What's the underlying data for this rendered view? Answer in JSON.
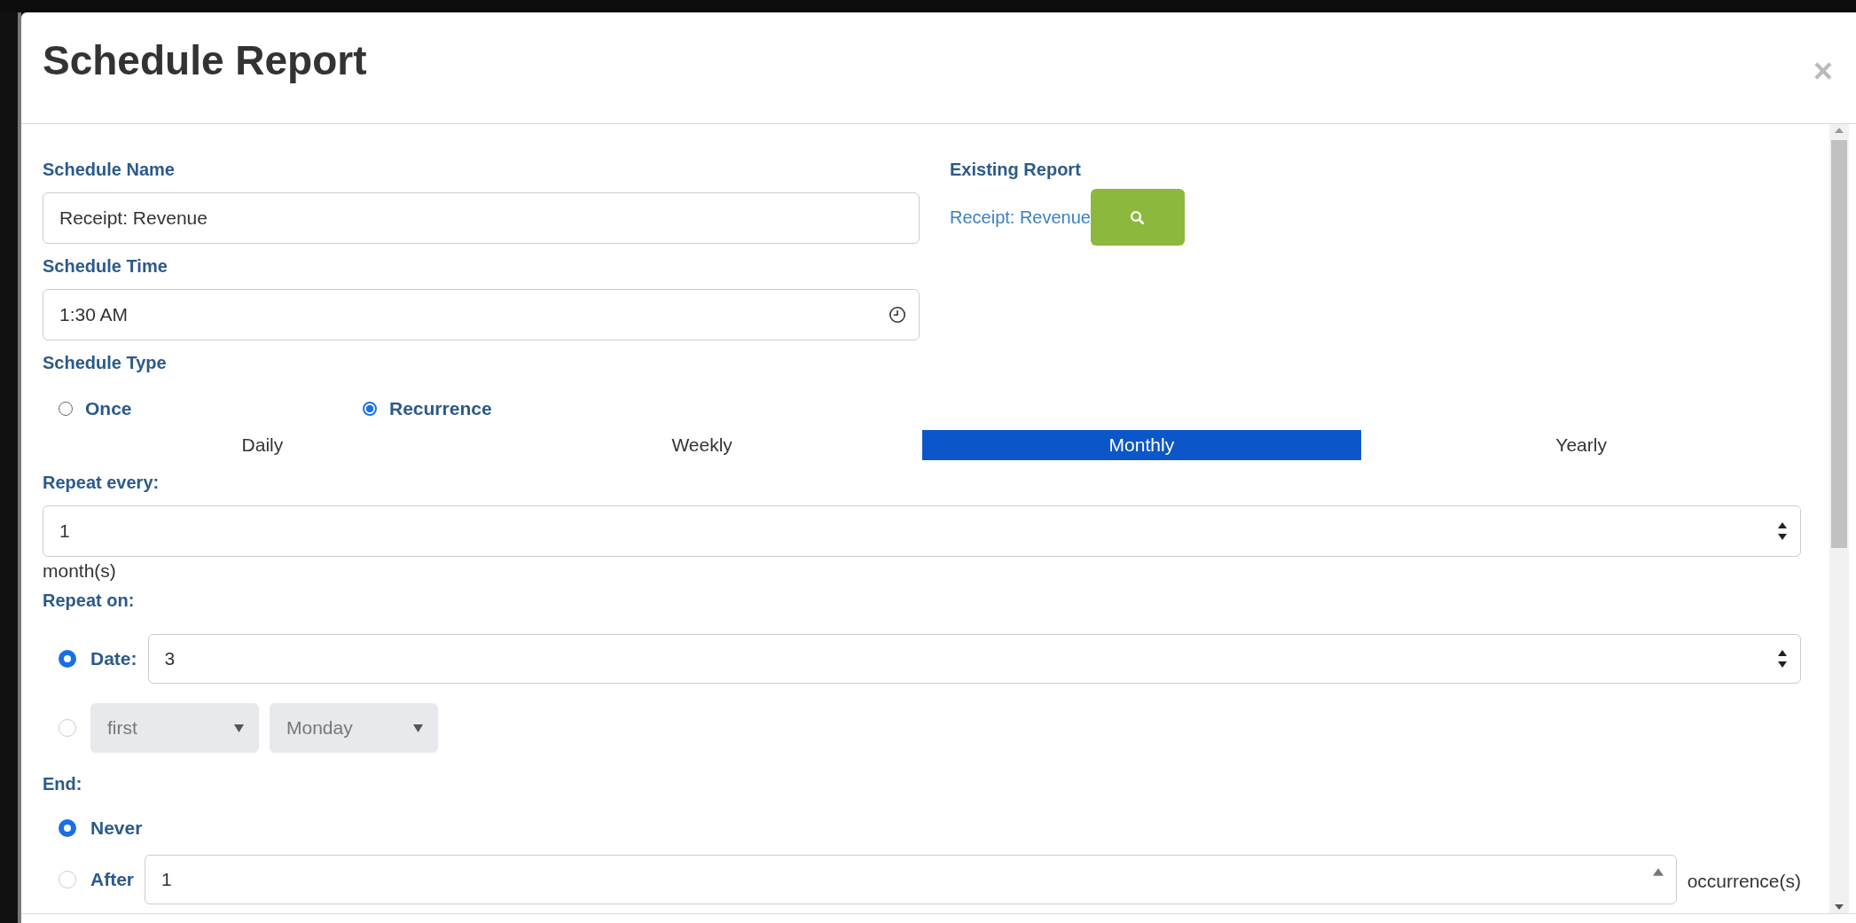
{
  "dialog": {
    "title": "Schedule Report",
    "close": "×"
  },
  "schedule_name": {
    "label": "Schedule Name",
    "value": "Receipt: Revenue"
  },
  "existing_report": {
    "label": "Existing Report",
    "link": "Receipt: Revenue"
  },
  "schedule_time": {
    "label": "Schedule Time",
    "value": "1:30 AM"
  },
  "schedule_type": {
    "label": "Schedule Type",
    "options": [
      {
        "label": "Once",
        "selected": false
      },
      {
        "label": "Recurrence",
        "selected": true
      }
    ]
  },
  "frequency_tabs": [
    {
      "label": "Daily",
      "selected": false
    },
    {
      "label": "Weekly",
      "selected": false
    },
    {
      "label": "Monthly",
      "selected": true
    },
    {
      "label": "Yearly",
      "selected": false
    }
  ],
  "repeat_every": {
    "label": "Repeat every:",
    "value": "1",
    "unit": "month(s)"
  },
  "repeat_on": {
    "label": "Repeat on:",
    "options": [
      {
        "kind": "date",
        "label": "Date:",
        "value": "3",
        "selected": true
      },
      {
        "kind": "weekday",
        "ordinal": "first",
        "weekday": "Monday",
        "selected": false,
        "disabled": true
      }
    ]
  },
  "end": {
    "label": "End:",
    "options": [
      {
        "kind": "never",
        "label": "Never",
        "selected": true
      },
      {
        "kind": "after",
        "label": "After",
        "value": "1",
        "unit": "occurrence(s)",
        "selected": false
      }
    ]
  }
}
